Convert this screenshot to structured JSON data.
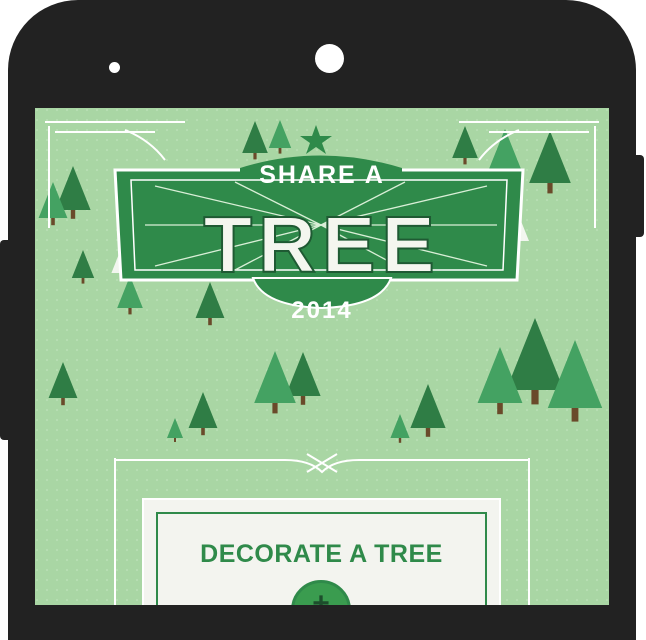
{
  "app": {
    "title_line1": "SHARE A",
    "title_main": "TREE",
    "year": "2014"
  },
  "actions": {
    "decorate_label": "DECORATE A TREE",
    "plus_symbol": "+"
  },
  "icons": {
    "plus": "plus-icon",
    "trees": "pine-tree-icon",
    "star": "star-icon"
  },
  "colors": {
    "background": "#a9d6a4",
    "banner": "#2f8a4a",
    "tree_dark": "#2f7d45",
    "tree_mid": "#3f9a58",
    "accent_text": "#2f8a4a"
  }
}
